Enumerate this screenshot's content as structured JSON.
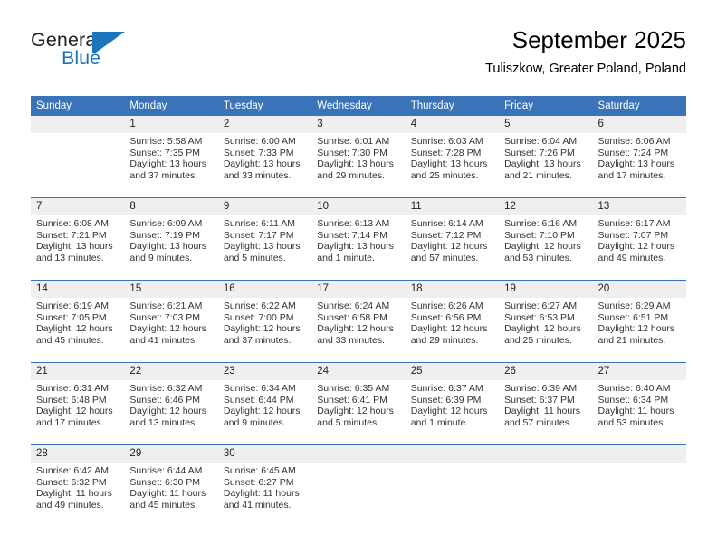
{
  "brand": {
    "name_part1": "General",
    "name_part2": "Blue",
    "logo_icon": "triangle-logo-icon",
    "accent_color": "#1b75bb"
  },
  "header": {
    "title": "September 2025",
    "subtitle": "Tuliszkow, Greater Poland, Poland"
  },
  "calendar": {
    "header_color": "#3a73b8",
    "daynum_background": "#efefef",
    "weekdays": [
      "Sunday",
      "Monday",
      "Tuesday",
      "Wednesday",
      "Thursday",
      "Friday",
      "Saturday"
    ],
    "weeks": [
      [
        {
          "day": "",
          "lines": [
            "",
            "",
            "",
            ""
          ]
        },
        {
          "day": "1",
          "lines": [
            "Sunrise: 5:58 AM",
            "Sunset: 7:35 PM",
            "Daylight: 13 hours",
            "and 37 minutes."
          ]
        },
        {
          "day": "2",
          "lines": [
            "Sunrise: 6:00 AM",
            "Sunset: 7:33 PM",
            "Daylight: 13 hours",
            "and 33 minutes."
          ]
        },
        {
          "day": "3",
          "lines": [
            "Sunrise: 6:01 AM",
            "Sunset: 7:30 PM",
            "Daylight: 13 hours",
            "and 29 minutes."
          ]
        },
        {
          "day": "4",
          "lines": [
            "Sunrise: 6:03 AM",
            "Sunset: 7:28 PM",
            "Daylight: 13 hours",
            "and 25 minutes."
          ]
        },
        {
          "day": "5",
          "lines": [
            "Sunrise: 6:04 AM",
            "Sunset: 7:26 PM",
            "Daylight: 13 hours",
            "and 21 minutes."
          ]
        },
        {
          "day": "6",
          "lines": [
            "Sunrise: 6:06 AM",
            "Sunset: 7:24 PM",
            "Daylight: 13 hours",
            "and 17 minutes."
          ]
        }
      ],
      [
        {
          "day": "7",
          "lines": [
            "Sunrise: 6:08 AM",
            "Sunset: 7:21 PM",
            "Daylight: 13 hours",
            "and 13 minutes."
          ]
        },
        {
          "day": "8",
          "lines": [
            "Sunrise: 6:09 AM",
            "Sunset: 7:19 PM",
            "Daylight: 13 hours",
            "and 9 minutes."
          ]
        },
        {
          "day": "9",
          "lines": [
            "Sunrise: 6:11 AM",
            "Sunset: 7:17 PM",
            "Daylight: 13 hours",
            "and 5 minutes."
          ]
        },
        {
          "day": "10",
          "lines": [
            "Sunrise: 6:13 AM",
            "Sunset: 7:14 PM",
            "Daylight: 13 hours",
            "and 1 minute."
          ]
        },
        {
          "day": "11",
          "lines": [
            "Sunrise: 6:14 AM",
            "Sunset: 7:12 PM",
            "Daylight: 12 hours",
            "and 57 minutes."
          ]
        },
        {
          "day": "12",
          "lines": [
            "Sunrise: 6:16 AM",
            "Sunset: 7:10 PM",
            "Daylight: 12 hours",
            "and 53 minutes."
          ]
        },
        {
          "day": "13",
          "lines": [
            "Sunrise: 6:17 AM",
            "Sunset: 7:07 PM",
            "Daylight: 12 hours",
            "and 49 minutes."
          ]
        }
      ],
      [
        {
          "day": "14",
          "lines": [
            "Sunrise: 6:19 AM",
            "Sunset: 7:05 PM",
            "Daylight: 12 hours",
            "and 45 minutes."
          ]
        },
        {
          "day": "15",
          "lines": [
            "Sunrise: 6:21 AM",
            "Sunset: 7:03 PM",
            "Daylight: 12 hours",
            "and 41 minutes."
          ]
        },
        {
          "day": "16",
          "lines": [
            "Sunrise: 6:22 AM",
            "Sunset: 7:00 PM",
            "Daylight: 12 hours",
            "and 37 minutes."
          ]
        },
        {
          "day": "17",
          "lines": [
            "Sunrise: 6:24 AM",
            "Sunset: 6:58 PM",
            "Daylight: 12 hours",
            "and 33 minutes."
          ]
        },
        {
          "day": "18",
          "lines": [
            "Sunrise: 6:26 AM",
            "Sunset: 6:56 PM",
            "Daylight: 12 hours",
            "and 29 minutes."
          ]
        },
        {
          "day": "19",
          "lines": [
            "Sunrise: 6:27 AM",
            "Sunset: 6:53 PM",
            "Daylight: 12 hours",
            "and 25 minutes."
          ]
        },
        {
          "day": "20",
          "lines": [
            "Sunrise: 6:29 AM",
            "Sunset: 6:51 PM",
            "Daylight: 12 hours",
            "and 21 minutes."
          ]
        }
      ],
      [
        {
          "day": "21",
          "lines": [
            "Sunrise: 6:31 AM",
            "Sunset: 6:48 PM",
            "Daylight: 12 hours",
            "and 17 minutes."
          ]
        },
        {
          "day": "22",
          "lines": [
            "Sunrise: 6:32 AM",
            "Sunset: 6:46 PM",
            "Daylight: 12 hours",
            "and 13 minutes."
          ]
        },
        {
          "day": "23",
          "lines": [
            "Sunrise: 6:34 AM",
            "Sunset: 6:44 PM",
            "Daylight: 12 hours",
            "and 9 minutes."
          ]
        },
        {
          "day": "24",
          "lines": [
            "Sunrise: 6:35 AM",
            "Sunset: 6:41 PM",
            "Daylight: 12 hours",
            "and 5 minutes."
          ]
        },
        {
          "day": "25",
          "lines": [
            "Sunrise: 6:37 AM",
            "Sunset: 6:39 PM",
            "Daylight: 12 hours",
            "and 1 minute."
          ]
        },
        {
          "day": "26",
          "lines": [
            "Sunrise: 6:39 AM",
            "Sunset: 6:37 PM",
            "Daylight: 11 hours",
            "and 57 minutes."
          ]
        },
        {
          "day": "27",
          "lines": [
            "Sunrise: 6:40 AM",
            "Sunset: 6:34 PM",
            "Daylight: 11 hours",
            "and 53 minutes."
          ]
        }
      ],
      [
        {
          "day": "28",
          "lines": [
            "Sunrise: 6:42 AM",
            "Sunset: 6:32 PM",
            "Daylight: 11 hours",
            "and 49 minutes."
          ]
        },
        {
          "day": "29",
          "lines": [
            "Sunrise: 6:44 AM",
            "Sunset: 6:30 PM",
            "Daylight: 11 hours",
            "and 45 minutes."
          ]
        },
        {
          "day": "30",
          "lines": [
            "Sunrise: 6:45 AM",
            "Sunset: 6:27 PM",
            "Daylight: 11 hours",
            "and 41 minutes."
          ]
        },
        {
          "day": "",
          "lines": [
            "",
            "",
            "",
            ""
          ]
        },
        {
          "day": "",
          "lines": [
            "",
            "",
            "",
            ""
          ]
        },
        {
          "day": "",
          "lines": [
            "",
            "",
            "",
            ""
          ]
        },
        {
          "day": "",
          "lines": [
            "",
            "",
            "",
            ""
          ]
        }
      ]
    ]
  }
}
